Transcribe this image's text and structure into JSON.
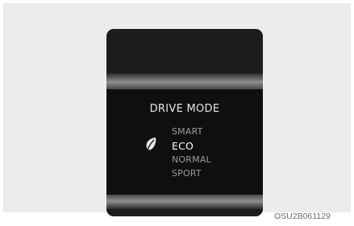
{
  "drive_mode": {
    "title": "DRIVE MODE",
    "options": [
      {
        "label": "SMART"
      },
      {
        "label": "ECO"
      },
      {
        "label": "NORMAL"
      },
      {
        "label": "SPORT"
      }
    ],
    "selected_index": 1,
    "selected_icon": "leaf-icon"
  },
  "caption": "OSU2B061129"
}
